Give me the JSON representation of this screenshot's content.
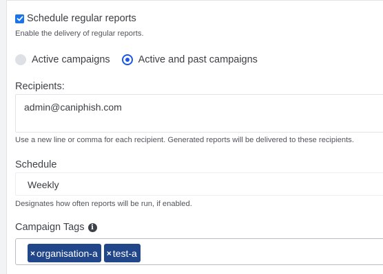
{
  "schedule_reports": {
    "label": "Schedule regular reports",
    "checked": true,
    "help": "Enable the delivery of regular reports."
  },
  "campaign_scope": {
    "options": [
      {
        "label": "Active campaigns",
        "selected": false
      },
      {
        "label": "Active and past campaigns",
        "selected": true
      }
    ]
  },
  "recipients": {
    "label": "Recipients:",
    "value": "admin@caniphish.com",
    "help": "Use a new line or comma for each recipient. Generated reports will be delivered to these recipients."
  },
  "schedule": {
    "label": "Schedule",
    "value": "Weekly",
    "help": "Designates how often reports will be run, if enabled."
  },
  "campaign_tags": {
    "label": "Campaign Tags",
    "info_icon": "info-circle-icon",
    "remove_glyph": "×",
    "tags": [
      "organisation-a",
      "test-a"
    ]
  },
  "colors": {
    "accent": "#1a56e8",
    "tag_bg": "#21478a"
  }
}
